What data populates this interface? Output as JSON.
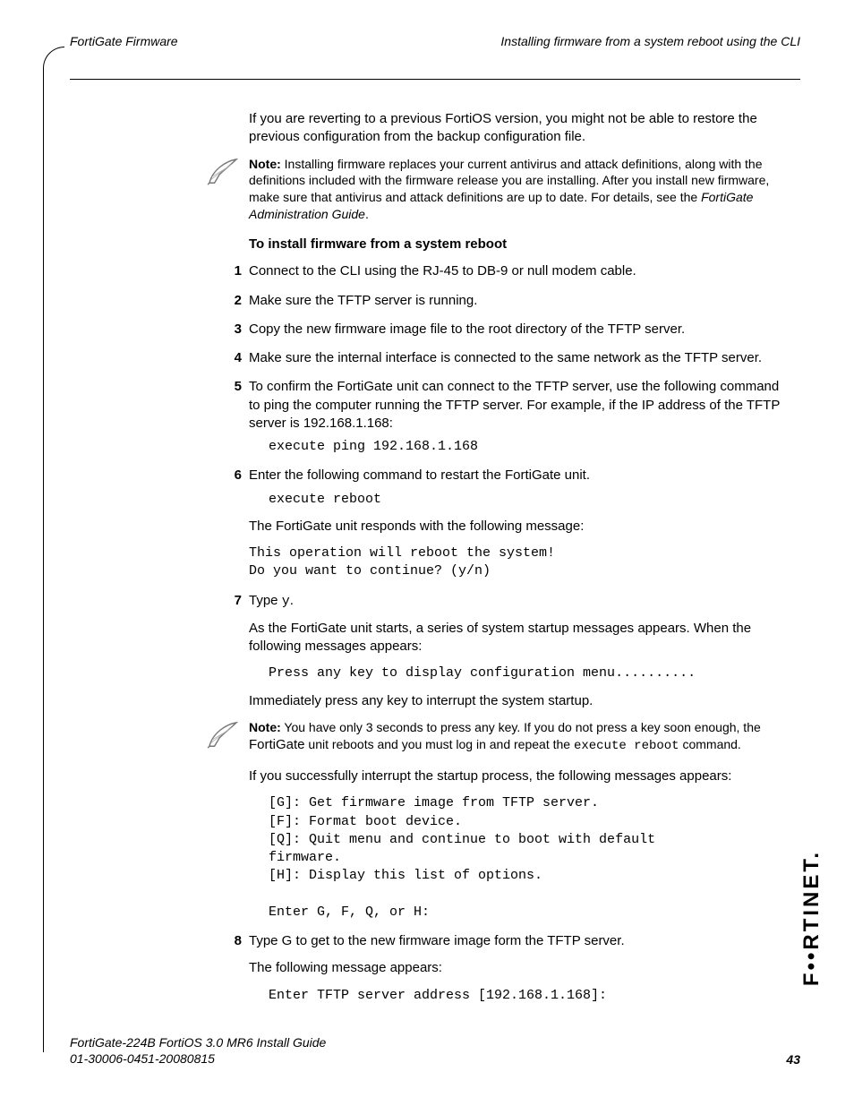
{
  "header": {
    "left": "FortiGate Firmware",
    "right": "Installing firmware from a system reboot using the CLI"
  },
  "intro": "If you are reverting to a previous FortiOS version, you might not be able to restore the previous configuration from the backup configuration file.",
  "note1": {
    "lead": "Note:",
    "body_a": " Installing firmware replaces your current antivirus and attack definitions, along with the definitions included with the firmware release you are installing. After you install new firmware, make sure that antivirus and attack definitions are up to date. For details, see the ",
    "body_em": "FortiGate Administration Guide",
    "body_b": "."
  },
  "section_head": "To install firmware from a system reboot",
  "steps": {
    "s1": {
      "n": "1",
      "t": "Connect to the CLI using the RJ-45 to DB-9 or null modem cable."
    },
    "s2": {
      "n": "2",
      "t": "Make sure the TFTP server is running."
    },
    "s3": {
      "n": "3",
      "t": "Copy the new firmware image file to the root directory of the TFTP server."
    },
    "s4": {
      "n": "4",
      "t": "Make sure the internal interface is connected to the same network as the TFTP server."
    },
    "s5": {
      "n": "5",
      "t": "To confirm the FortiGate unit can connect to the TFTP server, use the following command to ping the computer running the TFTP server. For example, if the IP address of the TFTP server is 192.168.1.168:",
      "code": "execute ping 192.168.1.168"
    },
    "s6": {
      "n": "6",
      "t": "Enter the following command to restart the FortiGate unit.",
      "code1": "execute reboot",
      "after1": "The FortiGate unit responds with the following message:",
      "code2": "This operation will reboot the system!\nDo you want to continue? (y/n)"
    },
    "s7": {
      "n": "7",
      "t_a": "Type ",
      "t_code": "y",
      "t_b": ".",
      "p2": "As the FortiGate unit starts, a series of system startup messages appears. When the following messages appears:",
      "code1": "Press any key to display configuration menu..........",
      "p3": "Immediately press any key to interrupt the system startup.",
      "note": {
        "lead": "Note:",
        "a": " You have only 3 seconds to press any key. If you do not press a key soon enough, the ",
        "mid": "FortiGate",
        "b": " unit reboots and you must log in and repeat the ",
        "code": "execute reboot",
        "c": " command."
      },
      "p4": "If you successfully interrupt the startup process, the following messages appears:",
      "code2": "[G]: Get firmware image from TFTP server.\n[F]: Format boot device.\n[Q]: Quit menu and continue to boot with default\nfirmware.\n[H]: Display this list of options.\n\nEnter G, F, Q, or H:"
    },
    "s8": {
      "n": "8",
      "t": "Type G to get to the new firmware image form the TFTP server.",
      "p2": "The following message appears:",
      "code": "Enter TFTP server address [192.168.1.168]:"
    }
  },
  "footer": {
    "line1": "FortiGate-224B FortiOS 3.0 MR6 Install Guide",
    "line2": "01-30006-0451-20080815",
    "page": "43"
  },
  "logo": "F••RTINET."
}
